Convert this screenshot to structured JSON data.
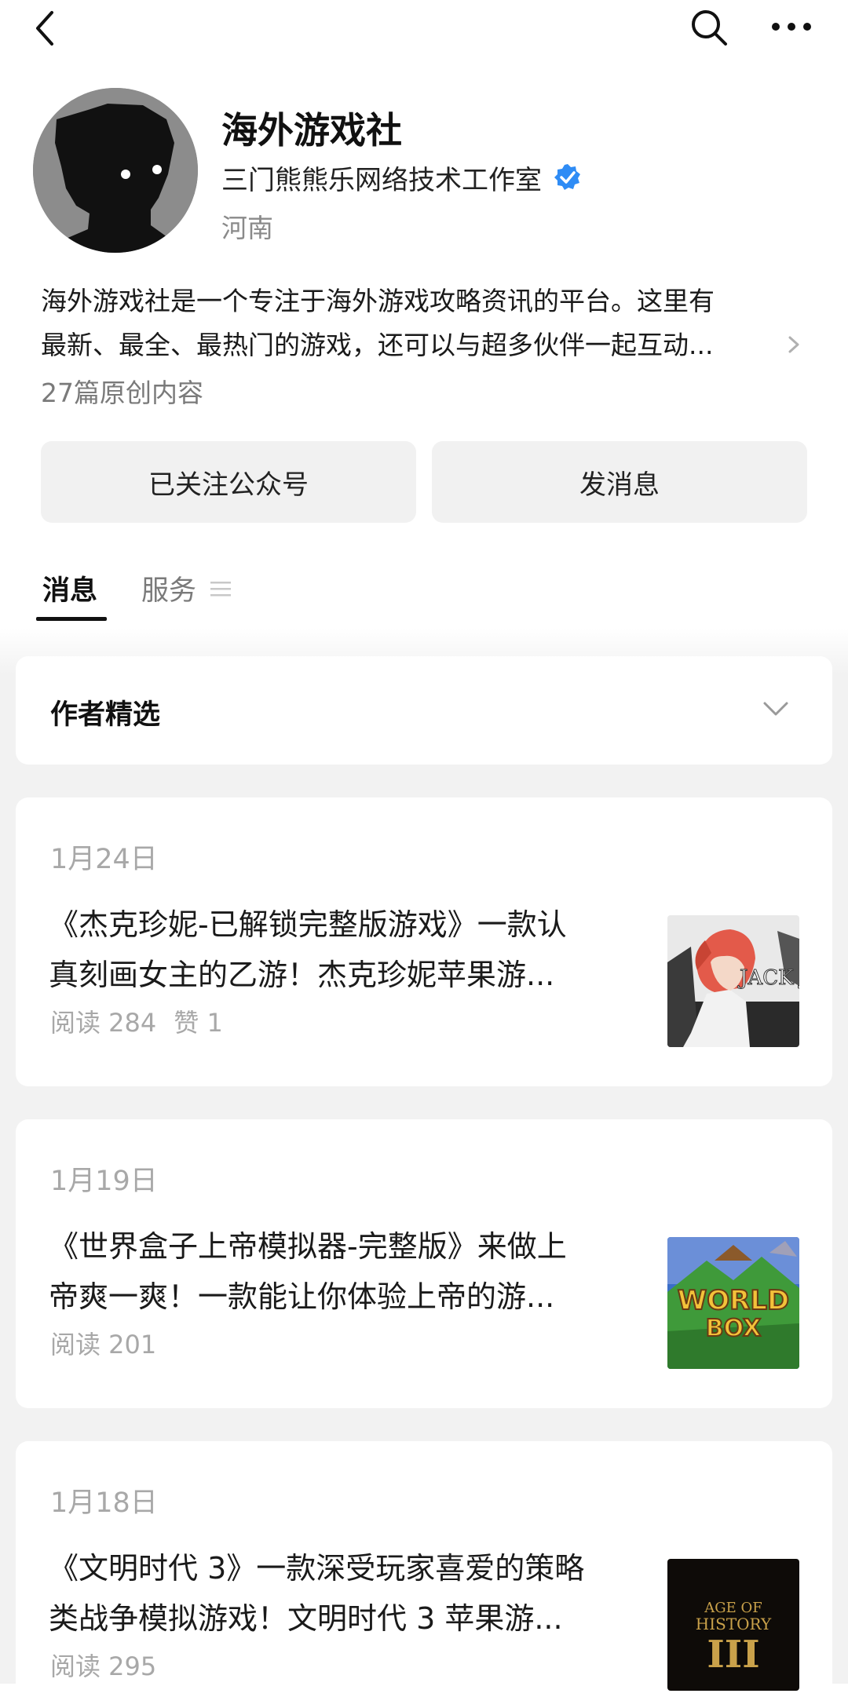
{
  "profile": {
    "name": "海外游戏社",
    "organization": "三门熊熊乐网络技术工作室",
    "region": "河南",
    "description_lines": [
      "海外游戏社是一个专注于海外游戏攻略资讯的平台。这里有",
      "最新、最全、最热门的游戏，还可以与超多伙伴一起互动..."
    ],
    "original_count": "27篇原创内容"
  },
  "actions": {
    "follow_label": "已关注公众号",
    "message_label": "发消息"
  },
  "tabs": [
    {
      "label": "消息",
      "active": true
    },
    {
      "label": "服务",
      "active": false
    }
  ],
  "author_picks": {
    "title": "作者精选"
  },
  "articles": [
    {
      "date": "1月24日",
      "title_lines": [
        "《杰克珍妮-已解锁完整版游戏》一款认",
        "真刻画女主的乙游！杰克珍妮苹果游..."
      ],
      "reads": "阅读 284",
      "likes": "赞 1",
      "thumb_text": "JACK JEAN"
    },
    {
      "date": "1月19日",
      "title_lines": [
        "《世界盒子上帝模拟器-完整版》来做上",
        "帝爽一爽！一款能让你体验上帝的游..."
      ],
      "reads": "阅读 201",
      "thumb_text": [
        "WORLD",
        "BOX"
      ]
    },
    {
      "date": "1月18日",
      "title_lines": [
        "《文明时代 3》一款深受玩家喜爱的策略",
        "类战争模拟游戏！文明时代 3 苹果游..."
      ],
      "reads": "阅读 295",
      "thumb_text": [
        "AGE OF",
        "HISTORY",
        "III"
      ]
    }
  ],
  "colors": {
    "verified": "#2f8cf5",
    "muted": "#a8a8a8",
    "button_bg": "#f1f1f1"
  },
  "icons": [
    "back-arrow-icon",
    "search-icon",
    "more-dots-icon",
    "verified-icon",
    "chevron-right-icon",
    "menu-icon",
    "chevron-down-icon"
  ]
}
